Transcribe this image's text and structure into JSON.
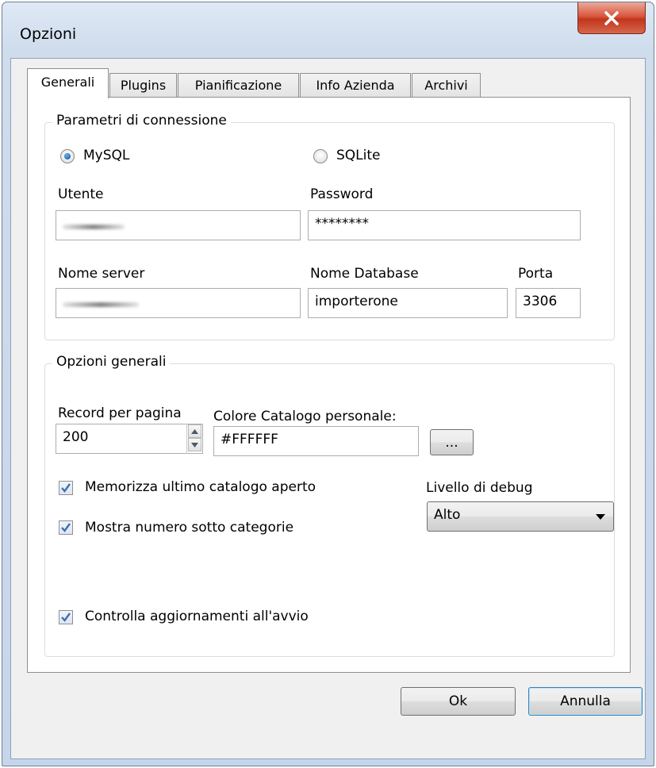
{
  "window": {
    "title": "Opzioni"
  },
  "tabs": [
    {
      "label": "Generali",
      "active": true
    },
    {
      "label": "Plugins"
    },
    {
      "label": "Pianificazione"
    },
    {
      "label": "Info Azienda"
    },
    {
      "label": "Archivi"
    }
  ],
  "connection": {
    "title": "Parametri di connessione",
    "mysql_label": "MySQL",
    "sqlite_label": "SQLite",
    "selected": "MySQL",
    "user_label": "Utente",
    "password_label": "Password",
    "password_value": "********",
    "server_label": "Nome server",
    "database_label": "Nome Database",
    "database_value": "importerone",
    "port_label": "Porta",
    "port_value": "3306"
  },
  "general": {
    "title": "Opzioni generali",
    "records_label": "Record per pagina",
    "records_value": "200",
    "color_label": "Colore Catalogo personale:",
    "color_value": "#FFFFFF",
    "browse_label": "...",
    "remember_catalog_label": "Memorizza ultimo catalogo aperto",
    "show_subcategories_label": "Mostra numero sotto categorie",
    "check_updates_label": "Controlla aggiornamenti all'avvio",
    "debug_label": "Livello di debug",
    "debug_value": "Alto"
  },
  "buttons": {
    "ok": "Ok",
    "cancel": "Annulla"
  },
  "colors": {
    "close_red": "#c2361c",
    "accent_blue": "#1b5fa8",
    "check_blue": "#3b6fb6"
  }
}
